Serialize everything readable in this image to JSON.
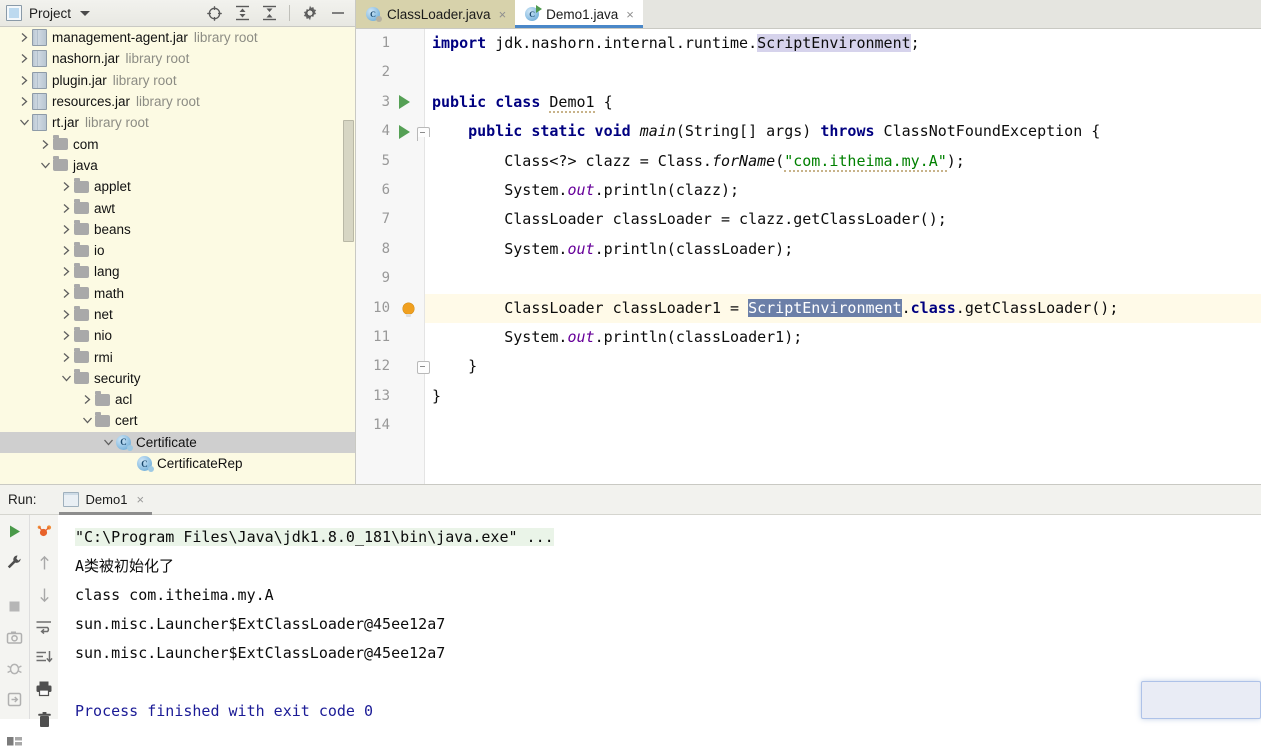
{
  "project_panel": {
    "header": {
      "title": "Project",
      "icon": "project-window-icon",
      "caret": "chevron-down-icon",
      "tools": [
        "locate-icon",
        "expand-all-icon",
        "collapse-all-icon",
        "settings-gear-icon",
        "minimize-icon"
      ]
    },
    "tree": [
      {
        "label": "management-agent.jar",
        "suffix": "library root",
        "icon": "jar-icon",
        "indent": 1,
        "arrow": "collapsed",
        "selected": false
      },
      {
        "label": "nashorn.jar",
        "suffix": "library root",
        "icon": "jar-icon",
        "indent": 1,
        "arrow": "collapsed",
        "selected": false
      },
      {
        "label": "plugin.jar",
        "suffix": "library root",
        "icon": "jar-icon",
        "indent": 1,
        "arrow": "collapsed",
        "selected": false
      },
      {
        "label": "resources.jar",
        "suffix": "library root",
        "icon": "jar-icon",
        "indent": 1,
        "arrow": "collapsed",
        "selected": false
      },
      {
        "label": "rt.jar",
        "suffix": "library root",
        "icon": "jar-icon",
        "indent": 1,
        "arrow": "expanded",
        "selected": false
      },
      {
        "label": "com",
        "suffix": "",
        "icon": "folder-icon",
        "indent": 2,
        "arrow": "collapsed",
        "selected": false
      },
      {
        "label": "java",
        "suffix": "",
        "icon": "folder-icon",
        "indent": 2,
        "arrow": "expanded",
        "selected": false
      },
      {
        "label": "applet",
        "suffix": "",
        "icon": "folder-icon",
        "indent": 3,
        "arrow": "collapsed",
        "selected": false
      },
      {
        "label": "awt",
        "suffix": "",
        "icon": "folder-icon",
        "indent": 3,
        "arrow": "collapsed",
        "selected": false
      },
      {
        "label": "beans",
        "suffix": "",
        "icon": "folder-icon",
        "indent": 3,
        "arrow": "collapsed",
        "selected": false
      },
      {
        "label": "io",
        "suffix": "",
        "icon": "folder-icon",
        "indent": 3,
        "arrow": "collapsed",
        "selected": false
      },
      {
        "label": "lang",
        "suffix": "",
        "icon": "folder-icon",
        "indent": 3,
        "arrow": "collapsed",
        "selected": false
      },
      {
        "label": "math",
        "suffix": "",
        "icon": "folder-icon",
        "indent": 3,
        "arrow": "collapsed",
        "selected": false
      },
      {
        "label": "net",
        "suffix": "",
        "icon": "folder-icon",
        "indent": 3,
        "arrow": "collapsed",
        "selected": false
      },
      {
        "label": "nio",
        "suffix": "",
        "icon": "folder-icon",
        "indent": 3,
        "arrow": "collapsed",
        "selected": false
      },
      {
        "label": "rmi",
        "suffix": "",
        "icon": "folder-icon",
        "indent": 3,
        "arrow": "collapsed",
        "selected": false
      },
      {
        "label": "security",
        "suffix": "",
        "icon": "folder-icon",
        "indent": 3,
        "arrow": "expanded",
        "selected": false
      },
      {
        "label": "acl",
        "suffix": "",
        "icon": "folder-icon",
        "indent": 4,
        "arrow": "collapsed",
        "selected": false
      },
      {
        "label": "cert",
        "suffix": "",
        "icon": "folder-icon",
        "indent": 4,
        "arrow": "expanded",
        "selected": false
      },
      {
        "label": "Certificate",
        "suffix": "",
        "icon": "java-class-icon",
        "indent": 5,
        "arrow": "expanded",
        "selected": true
      },
      {
        "label": "CertificateRep",
        "suffix": "",
        "icon": "java-class-icon",
        "indent": 6,
        "arrow": "none",
        "selected": false
      }
    ]
  },
  "editor": {
    "tabs": [
      {
        "label": "ClassLoader.java",
        "icon": "java-class-icon",
        "active": false,
        "close": "×"
      },
      {
        "label": "Demo1.java",
        "icon": "java-runnable-class-icon",
        "active": true,
        "close": "×"
      }
    ],
    "line_numbers": [
      "1",
      "2",
      "3",
      "4",
      "5",
      "6",
      "7",
      "8",
      "9",
      "10",
      "11",
      "12",
      "13",
      "14"
    ],
    "current_line": 10,
    "gutter_markers": [
      {
        "line": 3,
        "type": "run-gutter-icon"
      },
      {
        "line": 4,
        "type": "run-gutter-icon"
      },
      {
        "line": 4,
        "type": "fold-marker-icon"
      },
      {
        "line": 10,
        "type": "intention-bulb-icon"
      },
      {
        "line": 12,
        "type": "fold-end-marker-icon"
      }
    ],
    "code_lines": [
      "import jdk.nashorn.internal.runtime.ScriptEnvironment;",
      "",
      "public class Demo1 {",
      "    public static void main(String[] args) throws ClassNotFoundException {",
      "        Class<?> clazz = Class.forName(\"com.itheima.my.A\");",
      "        System.out.println(clazz);",
      "        ClassLoader classLoader = clazz.getClassLoader();",
      "        System.out.println(classLoader);",
      "",
      "        ClassLoader classLoader1 = ScriptEnvironment.class.getClassLoader();",
      "        System.out.println(classLoader1);",
      "    }",
      "}",
      ""
    ],
    "selected_text": "ScriptEnvironment",
    "highlighted_identifier": "ScriptEnvironment",
    "colors": {
      "keyword": "#000080",
      "string": "#008000",
      "field": "#660099",
      "selection_bg": "#6b7fa8",
      "identifier_highlight_bg": "#d6d3ec",
      "current_line_bg": "#fffae8"
    }
  },
  "run_panel": {
    "label": "Run:",
    "tab": {
      "label": "Demo1",
      "icon": "console-tab-icon",
      "close": "×"
    },
    "toolbar_left": [
      "rerun-play-icon",
      "settings-wrench-icon",
      "stop-icon",
      "camera-snapshot-icon",
      "debug-bug-icon",
      "export-icon",
      "layout-icon"
    ],
    "toolbar_right": [
      "rerun-tests-icon",
      "up-arrow-icon",
      "down-arrow-icon",
      "soft-wrap-icon",
      "scroll-to-end-icon",
      "print-icon",
      "trash-icon"
    ],
    "console_lines": [
      {
        "text": "\"C:\\Program Files\\Java\\jdk1.8.0_181\\bin\\java.exe\" ...",
        "style": "command"
      },
      {
        "text": "A类被初始化了",
        "style": "normal"
      },
      {
        "text": "class com.itheima.my.A",
        "style": "normal"
      },
      {
        "text": "sun.misc.Launcher$ExtClassLoader@45ee12a7",
        "style": "normal"
      },
      {
        "text": "sun.misc.Launcher$ExtClassLoader@45ee12a7",
        "style": "normal"
      },
      {
        "text": "",
        "style": "normal"
      },
      {
        "text": "Process finished with exit code 0",
        "style": "blue"
      }
    ]
  },
  "popup": {
    "name": "notification-popup"
  }
}
